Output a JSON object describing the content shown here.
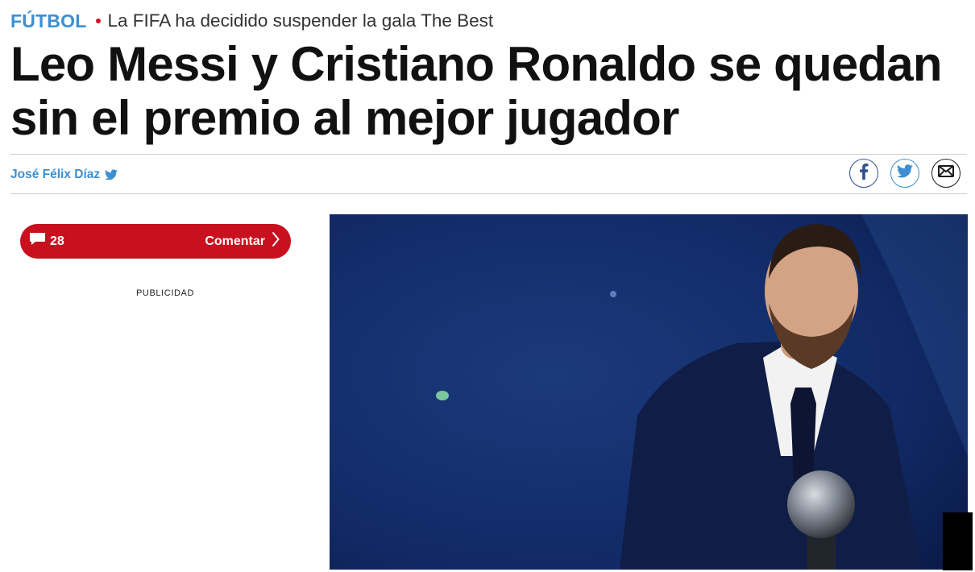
{
  "article": {
    "section": "FÚTBOL",
    "subtitle": "La FIFA ha decidido suspender la gala The Best",
    "headline": "Leo Messi y Cristiano Ronaldo se quedan sin el premio al mejor jugador",
    "author": "José Félix Díaz"
  },
  "share": {
    "icons": [
      "facebook-icon",
      "twitter-icon",
      "email-icon"
    ]
  },
  "comments": {
    "count": "28",
    "button_label": "Comentar"
  },
  "ad": {
    "label": "PUBLICIDAD"
  },
  "colors": {
    "accent_blue": "#3d8fd1",
    "brand_red": "#c8101e",
    "headline": "#111111"
  }
}
